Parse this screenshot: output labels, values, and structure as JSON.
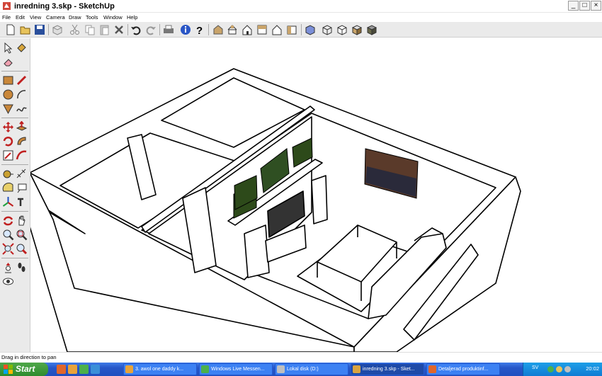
{
  "window": {
    "title": "inredning 3.skp - SketchUp",
    "buttons": {
      "minimize": "_",
      "maximize": "□",
      "close": "×"
    }
  },
  "menu": [
    "File",
    "Edit",
    "View",
    "Camera",
    "Draw",
    "Tools",
    "Window",
    "Help"
  ],
  "toolbar": {
    "icons": [
      "new-icon",
      "open-icon",
      "save-icon",
      "make-component-icon",
      "cut-icon",
      "copy-icon",
      "paste-icon",
      "erase-icon",
      "undo-icon",
      "redo-icon",
      "print-icon",
      "model-info-icon",
      "help-icon",
      "iso-view-icon",
      "top-view-icon",
      "front-view-icon",
      "right-view-icon",
      "back-view-icon",
      "left-view-icon",
      "xray-icon",
      "wireframe-icon",
      "hidden-line-icon",
      "shaded-icon",
      "shaded-textures-icon"
    ]
  },
  "left_toolbar": {
    "icons": [
      "select-icon",
      "paint-bucket-icon",
      "eraser-icon",
      "rectangle-icon",
      "line-icon",
      "circle-icon",
      "arc-icon",
      "polygon-icon",
      "freehand-icon",
      "move-icon",
      "push-pull-icon",
      "rotate-icon",
      "follow-me-icon",
      "scale-icon",
      "offset-icon",
      "tape-measure-icon",
      "dimension-icon",
      "protractor-icon",
      "text-icon",
      "axes-icon",
      "3d-text-icon",
      "orbit-icon",
      "pan-icon",
      "zoom-icon",
      "zoom-window-icon",
      "zoom-extents-icon",
      "previous-view-icon",
      "position-camera-icon",
      "walk-icon",
      "look-around-icon"
    ]
  },
  "status": {
    "text": "Drag in direction to pan"
  },
  "taskbar": {
    "start_label": "Start",
    "tasks": [
      {
        "label": "3. awol one  daddy k...",
        "active": false,
        "color": "#e8a33a"
      },
      {
        "label": "Windows Live Messen...",
        "active": false,
        "color": "#4bb04b"
      },
      {
        "label": "Lokal disk (D:)",
        "active": false,
        "color": "#bfbfbf"
      },
      {
        "label": "inredning 3.skp - Sket...",
        "active": true,
        "color": "#d9a441"
      },
      {
        "label": "Detaljerad produktinf...",
        "active": false,
        "color": "#e0662a"
      }
    ],
    "language": "SV",
    "clock": "20:02"
  }
}
